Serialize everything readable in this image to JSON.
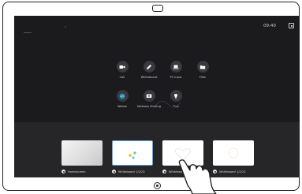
{
  "status": {
    "time": "09:40",
    "top_indicator": "›"
  },
  "apps": [
    {
      "label": "Call",
      "icon": "video-camera-icon"
    },
    {
      "label": "Whiteboard",
      "icon": "pencil-icon"
    },
    {
      "label": "PC Input",
      "icon": "laptop-icon"
    },
    {
      "label": "Files",
      "icon": "folder-icon"
    },
    {
      "label": "Webex",
      "icon": "webex-icon"
    },
    {
      "label": "Wireless Sharing",
      "icon": "screen-share-icon"
    },
    {
      "label": "Tips",
      "icon": "lightbulb-icon"
    }
  ],
  "tray": {
    "items": [
      {
        "label": "Homescreen"
      },
      {
        "label": "Whiteboard 1/2/23"
      },
      {
        "label": "Whiteboard 1/2/23"
      },
      {
        "label": "Whiteboard 1/2/23"
      }
    ]
  },
  "colors": {
    "screen_bg": "#1b1b1d",
    "tray_bg": "#262628",
    "selected_border": "#62a8e8"
  }
}
